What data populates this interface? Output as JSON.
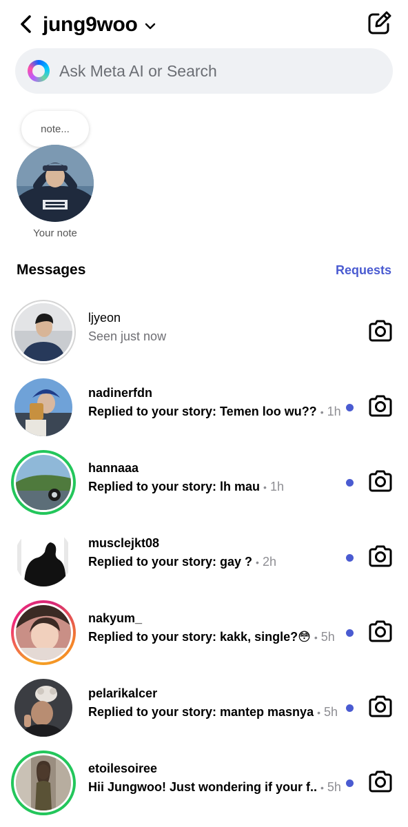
{
  "header": {
    "account_name": "jung9woo",
    "back_icon": "chevron-left-icon",
    "dropdown_icon": "chevron-down-icon",
    "compose_icon": "compose-icon"
  },
  "search": {
    "placeholder": "Ask Meta AI or Search",
    "icon": "meta-ai-icon"
  },
  "note": {
    "bubble_text": "note...",
    "label": "Your note"
  },
  "messages": {
    "title": "Messages",
    "requests_label": "Requests",
    "accent_color": "#4a5bd1",
    "conversations": [
      {
        "username": "ljyeon",
        "preview": "Seen just now",
        "time": "",
        "unread": false,
        "ring": "seen"
      },
      {
        "username": "nadinerfdn",
        "preview": "Replied to your story: Temen loo wu??",
        "time": "1h",
        "unread": true,
        "ring": "none"
      },
      {
        "username": "hannaaa",
        "preview": "Replied to your story: lh mau",
        "time": "1h",
        "unread": true,
        "ring": "close-friends"
      },
      {
        "username": "musclejkt08",
        "preview": "Replied to your story: gay ?",
        "time": "2h",
        "unread": true,
        "ring": "none"
      },
      {
        "username": "nakyum_",
        "preview": "Replied to your story: kakk, single?😳",
        "time": "5h",
        "unread": true,
        "ring": "story"
      },
      {
        "username": "pelarikalcer",
        "preview": "Replied to your story: mantep masnya",
        "time": "5h",
        "unread": true,
        "ring": "none"
      },
      {
        "username": "etoilesoiree",
        "preview": "Hii Jungwoo! Just wondering if your f..",
        "time": "5h",
        "unread": true,
        "ring": "close-friends"
      }
    ]
  }
}
